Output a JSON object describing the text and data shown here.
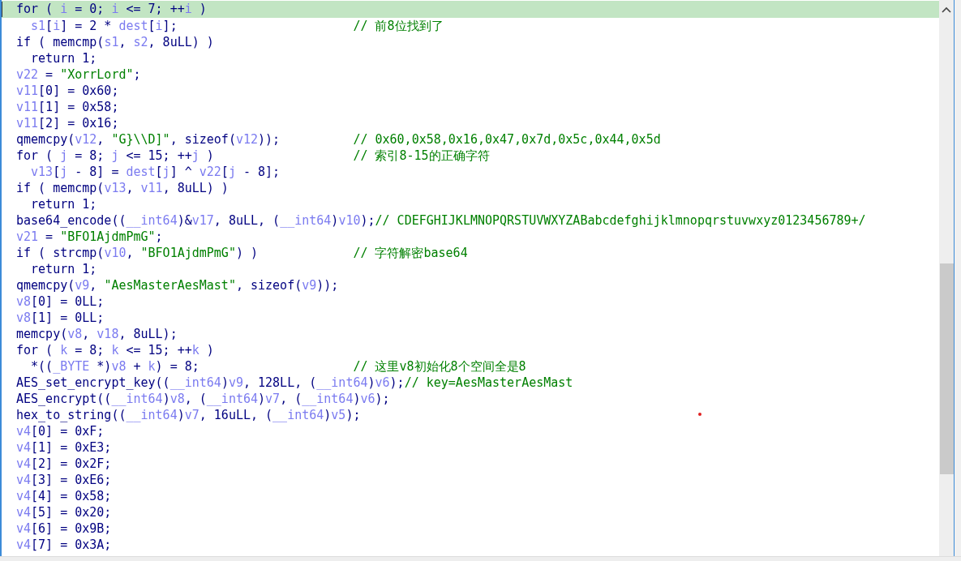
{
  "code_lines": [
    {
      "selected": true,
      "indented": false,
      "code": [
        {
          "kind": "p",
          "text": "for ( "
        },
        {
          "kind": "v",
          "text": "i"
        },
        {
          "kind": "p",
          "text": " = 0; "
        },
        {
          "kind": "v",
          "text": "i"
        },
        {
          "kind": "p",
          "text": " <= 7; ++"
        },
        {
          "kind": "v",
          "text": "i"
        },
        {
          "kind": "p",
          "text": " )"
        }
      ]
    },
    {
      "selected": false,
      "indented": true,
      "code": [
        {
          "kind": "v",
          "text": "s1"
        },
        {
          "kind": "p",
          "text": "["
        },
        {
          "kind": "v",
          "text": "i"
        },
        {
          "kind": "p",
          "text": "] = 2 * "
        },
        {
          "kind": "v",
          "text": "dest"
        },
        {
          "kind": "p",
          "text": "["
        },
        {
          "kind": "v",
          "text": "i"
        },
        {
          "kind": "p",
          "text": "];"
        }
      ],
      "comment": "// 前8位找到了"
    },
    {
      "selected": false,
      "indented": false,
      "code": [
        {
          "kind": "p",
          "text": "if ( memcmp("
        },
        {
          "kind": "v",
          "text": "s1"
        },
        {
          "kind": "p",
          "text": ", "
        },
        {
          "kind": "v",
          "text": "s2"
        },
        {
          "kind": "p",
          "text": ", 8uLL) )"
        }
      ]
    },
    {
      "selected": false,
      "indented": true,
      "code": [
        {
          "kind": "p",
          "text": "return 1;"
        }
      ]
    },
    {
      "selected": false,
      "indented": false,
      "code": [
        {
          "kind": "v",
          "text": "v22"
        },
        {
          "kind": "p",
          "text": " = "
        },
        {
          "kind": "s",
          "text": "\"XorrLord\""
        },
        {
          "kind": "p",
          "text": ";"
        }
      ]
    },
    {
      "selected": false,
      "indented": false,
      "code": [
        {
          "kind": "v",
          "text": "v11"
        },
        {
          "kind": "p",
          "text": "[0] = 0x60;"
        }
      ]
    },
    {
      "selected": false,
      "indented": false,
      "code": [
        {
          "kind": "v",
          "text": "v11"
        },
        {
          "kind": "p",
          "text": "[1] = 0x58;"
        }
      ]
    },
    {
      "selected": false,
      "indented": false,
      "code": [
        {
          "kind": "v",
          "text": "v11"
        },
        {
          "kind": "p",
          "text": "[2] = 0x16;"
        }
      ]
    },
    {
      "selected": false,
      "indented": false,
      "code": [
        {
          "kind": "p",
          "text": "qmemcpy("
        },
        {
          "kind": "v",
          "text": "v12"
        },
        {
          "kind": "p",
          "text": ", "
        },
        {
          "kind": "s",
          "text": "\"G}\\\\D]\""
        },
        {
          "kind": "p",
          "text": ", sizeof("
        },
        {
          "kind": "v",
          "text": "v12"
        },
        {
          "kind": "p",
          "text": "));"
        }
      ],
      "comment": "// 0x60,0x58,0x16,0x47,0x7d,0x5c,0x44,0x5d"
    },
    {
      "selected": false,
      "indented": false,
      "code": [
        {
          "kind": "p",
          "text": "for ( "
        },
        {
          "kind": "v",
          "text": "j"
        },
        {
          "kind": "p",
          "text": " = 8; "
        },
        {
          "kind": "v",
          "text": "j"
        },
        {
          "kind": "p",
          "text": " <= 15; ++"
        },
        {
          "kind": "v",
          "text": "j"
        },
        {
          "kind": "p",
          "text": " )"
        }
      ],
      "comment": "// 索引8-15的正确字符"
    },
    {
      "selected": false,
      "indented": true,
      "code": [
        {
          "kind": "v",
          "text": "v13"
        },
        {
          "kind": "p",
          "text": "["
        },
        {
          "kind": "v",
          "text": "j"
        },
        {
          "kind": "p",
          "text": " - 8] = "
        },
        {
          "kind": "v",
          "text": "dest"
        },
        {
          "kind": "p",
          "text": "["
        },
        {
          "kind": "v",
          "text": "j"
        },
        {
          "kind": "p",
          "text": "] ^ "
        },
        {
          "kind": "v",
          "text": "v22"
        },
        {
          "kind": "p",
          "text": "["
        },
        {
          "kind": "v",
          "text": "j"
        },
        {
          "kind": "p",
          "text": " - 8];"
        }
      ]
    },
    {
      "selected": false,
      "indented": false,
      "code": [
        {
          "kind": "p",
          "text": "if ( memcmp("
        },
        {
          "kind": "v",
          "text": "v13"
        },
        {
          "kind": "p",
          "text": ", "
        },
        {
          "kind": "v",
          "text": "v11"
        },
        {
          "kind": "p",
          "text": ", 8uLL) )"
        }
      ]
    },
    {
      "selected": false,
      "indented": true,
      "code": [
        {
          "kind": "p",
          "text": "return 1;"
        }
      ]
    },
    {
      "selected": false,
      "indented": false,
      "code": [
        {
          "kind": "p",
          "text": "base64_encode(("
        },
        {
          "kind": "v",
          "text": "__int64"
        },
        {
          "kind": "p",
          "text": ")&"
        },
        {
          "kind": "v",
          "text": "v17"
        },
        {
          "kind": "p",
          "text": ", 8uLL, ("
        },
        {
          "kind": "v",
          "text": "__int64"
        },
        {
          "kind": "p",
          "text": ")"
        },
        {
          "kind": "v",
          "text": "v10"
        },
        {
          "kind": "p",
          "text": ");"
        }
      ],
      "comment": "// CDEFGHIJKLMNOPQRSTUVWXYZABabcdefghijklmnopqrstuvwxyz0123456789+/"
    },
    {
      "selected": false,
      "indented": false,
      "code": [
        {
          "kind": "v",
          "text": "v21"
        },
        {
          "kind": "p",
          "text": " = "
        },
        {
          "kind": "s",
          "text": "\"BFO1AjdmPmG\""
        },
        {
          "kind": "p",
          "text": ";"
        }
      ]
    },
    {
      "selected": false,
      "indented": false,
      "code": [
        {
          "kind": "p",
          "text": "if ( strcmp("
        },
        {
          "kind": "v",
          "text": "v10"
        },
        {
          "kind": "p",
          "text": ", "
        },
        {
          "kind": "s",
          "text": "\"BFO1AjdmPmG\""
        },
        {
          "kind": "p",
          "text": ") )"
        }
      ],
      "comment": "// 字符解密base64"
    },
    {
      "selected": false,
      "indented": true,
      "code": [
        {
          "kind": "p",
          "text": "return 1;"
        }
      ]
    },
    {
      "selected": false,
      "indented": false,
      "code": [
        {
          "kind": "p",
          "text": "qmemcpy("
        },
        {
          "kind": "v",
          "text": "v9"
        },
        {
          "kind": "p",
          "text": ", "
        },
        {
          "kind": "s",
          "text": "\"AesMasterAesMast\""
        },
        {
          "kind": "p",
          "text": ", sizeof("
        },
        {
          "kind": "v",
          "text": "v9"
        },
        {
          "kind": "p",
          "text": "));"
        }
      ]
    },
    {
      "selected": false,
      "indented": false,
      "code": [
        {
          "kind": "v",
          "text": "v8"
        },
        {
          "kind": "p",
          "text": "[0] = 0LL;"
        }
      ]
    },
    {
      "selected": false,
      "indented": false,
      "code": [
        {
          "kind": "v",
          "text": "v8"
        },
        {
          "kind": "p",
          "text": "[1] = 0LL;"
        }
      ]
    },
    {
      "selected": false,
      "indented": false,
      "code": [
        {
          "kind": "p",
          "text": "memcpy("
        },
        {
          "kind": "v",
          "text": "v8"
        },
        {
          "kind": "p",
          "text": ", "
        },
        {
          "kind": "v",
          "text": "v18"
        },
        {
          "kind": "p",
          "text": ", 8uLL);"
        }
      ]
    },
    {
      "selected": false,
      "indented": false,
      "code": [
        {
          "kind": "p",
          "text": "for ( "
        },
        {
          "kind": "v",
          "text": "k"
        },
        {
          "kind": "p",
          "text": " = 8; "
        },
        {
          "kind": "v",
          "text": "k"
        },
        {
          "kind": "p",
          "text": " <= 15; ++"
        },
        {
          "kind": "v",
          "text": "k"
        },
        {
          "kind": "p",
          "text": " )"
        }
      ]
    },
    {
      "selected": false,
      "indented": true,
      "code": [
        {
          "kind": "p",
          "text": "*(("
        },
        {
          "kind": "v",
          "text": "_BYTE"
        },
        {
          "kind": "p",
          "text": " *)"
        },
        {
          "kind": "v",
          "text": "v8"
        },
        {
          "kind": "p",
          "text": " + "
        },
        {
          "kind": "v",
          "text": "k"
        },
        {
          "kind": "p",
          "text": ") = 8;"
        }
      ],
      "comment": "// 这里v8初始化8个空间全是8"
    },
    {
      "selected": false,
      "indented": false,
      "code": [
        {
          "kind": "p",
          "text": "AES_set_encrypt_key(("
        },
        {
          "kind": "v",
          "text": "__int64"
        },
        {
          "kind": "p",
          "text": ")"
        },
        {
          "kind": "v",
          "text": "v9"
        },
        {
          "kind": "p",
          "text": ", 128LL, ("
        },
        {
          "kind": "v",
          "text": "__int64"
        },
        {
          "kind": "p",
          "text": ")"
        },
        {
          "kind": "v",
          "text": "v6"
        },
        {
          "kind": "p",
          "text": ");"
        }
      ],
      "comment": "// key=AesMasterAesMast"
    },
    {
      "selected": false,
      "indented": false,
      "code": [
        {
          "kind": "p",
          "text": "AES_encrypt(("
        },
        {
          "kind": "v",
          "text": "__int64"
        },
        {
          "kind": "p",
          "text": ")"
        },
        {
          "kind": "v",
          "text": "v8"
        },
        {
          "kind": "p",
          "text": ", ("
        },
        {
          "kind": "v",
          "text": "__int64"
        },
        {
          "kind": "p",
          "text": ")"
        },
        {
          "kind": "v",
          "text": "v7"
        },
        {
          "kind": "p",
          "text": ", ("
        },
        {
          "kind": "v",
          "text": "__int64"
        },
        {
          "kind": "p",
          "text": ")"
        },
        {
          "kind": "v",
          "text": "v6"
        },
        {
          "kind": "p",
          "text": ");"
        }
      ]
    },
    {
      "selected": false,
      "indented": false,
      "code": [
        {
          "kind": "p",
          "text": "hex_to_string(("
        },
        {
          "kind": "v",
          "text": "__int64"
        },
        {
          "kind": "p",
          "text": ")"
        },
        {
          "kind": "v",
          "text": "v7"
        },
        {
          "kind": "p",
          "text": ", 16uLL, ("
        },
        {
          "kind": "v",
          "text": "__int64"
        },
        {
          "kind": "p",
          "text": ")"
        },
        {
          "kind": "v",
          "text": "v5"
        },
        {
          "kind": "p",
          "text": ");"
        }
      ]
    },
    {
      "selected": false,
      "indented": false,
      "code": [
        {
          "kind": "v",
          "text": "v4"
        },
        {
          "kind": "p",
          "text": "[0] = 0xF;"
        }
      ]
    },
    {
      "selected": false,
      "indented": false,
      "code": [
        {
          "kind": "v",
          "text": "v4"
        },
        {
          "kind": "p",
          "text": "[1] = 0xE3;"
        }
      ]
    },
    {
      "selected": false,
      "indented": false,
      "code": [
        {
          "kind": "v",
          "text": "v4"
        },
        {
          "kind": "p",
          "text": "[2] = 0x2F;"
        }
      ]
    },
    {
      "selected": false,
      "indented": false,
      "code": [
        {
          "kind": "v",
          "text": "v4"
        },
        {
          "kind": "p",
          "text": "[3] = 0xE6;"
        }
      ]
    },
    {
      "selected": false,
      "indented": false,
      "code": [
        {
          "kind": "v",
          "text": "v4"
        },
        {
          "kind": "p",
          "text": "[4] = 0x58;"
        }
      ]
    },
    {
      "selected": false,
      "indented": false,
      "code": [
        {
          "kind": "v",
          "text": "v4"
        },
        {
          "kind": "p",
          "text": "[5] = 0x20;"
        }
      ]
    },
    {
      "selected": false,
      "indented": false,
      "code": [
        {
          "kind": "v",
          "text": "v4"
        },
        {
          "kind": "p",
          "text": "[6] = 0x9B;"
        }
      ]
    },
    {
      "selected": false,
      "indented": false,
      "code": [
        {
          "kind": "v",
          "text": "v4"
        },
        {
          "kind": "p",
          "text": "[7] = 0x3A;"
        }
      ]
    }
  ]
}
